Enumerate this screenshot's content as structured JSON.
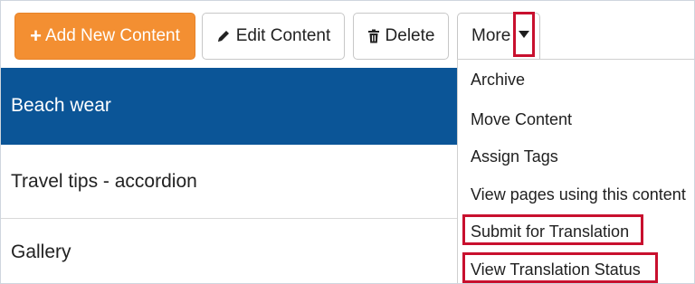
{
  "toolbar": {
    "add_label": "Add New Content",
    "edit_label": "Edit Content",
    "delete_label": "Delete",
    "more_label": "More"
  },
  "icons": {
    "add": "plus-icon",
    "edit": "pencil-icon",
    "delete": "trash-icon",
    "more": "caret-down-icon"
  },
  "content_list": {
    "items": [
      {
        "title": "Beach wear",
        "selected": true
      },
      {
        "title": "Travel tips - accordion",
        "selected": false
      },
      {
        "title": "Gallery",
        "selected": false
      }
    ]
  },
  "more_menu": {
    "items": [
      {
        "label": "Archive",
        "highlighted": false
      },
      {
        "label": "Move Content",
        "highlighted": false
      },
      {
        "label": "Assign Tags",
        "highlighted": false
      },
      {
        "label": "View pages using this content",
        "highlighted": false
      },
      {
        "label": "Submit for Translation",
        "highlighted": true
      },
      {
        "label": "View Translation Status",
        "highlighted": true
      }
    ]
  },
  "colors": {
    "primary_button": "#f38f32",
    "selected_row": "#0b5597",
    "highlight_outline": "#c8102e"
  }
}
